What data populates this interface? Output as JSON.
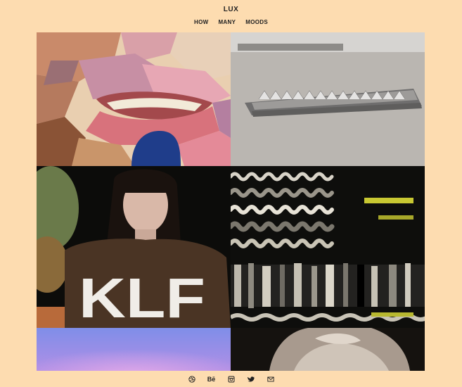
{
  "site": {
    "title": "LUX"
  },
  "nav": {
    "items": [
      "HOW",
      "MANY",
      "MOODS"
    ]
  },
  "gallery": {
    "tiles": [
      "abstract-lips-painting",
      "metal-sculpture-installation",
      "klf-shirt-portrait",
      "glitch-wave-image",
      "purple-gradient",
      "marble-sculpture"
    ]
  },
  "footer": {
    "icons": [
      "dribbble-icon",
      "behance-icon",
      "instagram-icon",
      "twitter-icon",
      "mail-icon"
    ],
    "behance_label": "Bē"
  },
  "colors": {
    "background": "#fddcb0",
    "text": "#222222"
  }
}
